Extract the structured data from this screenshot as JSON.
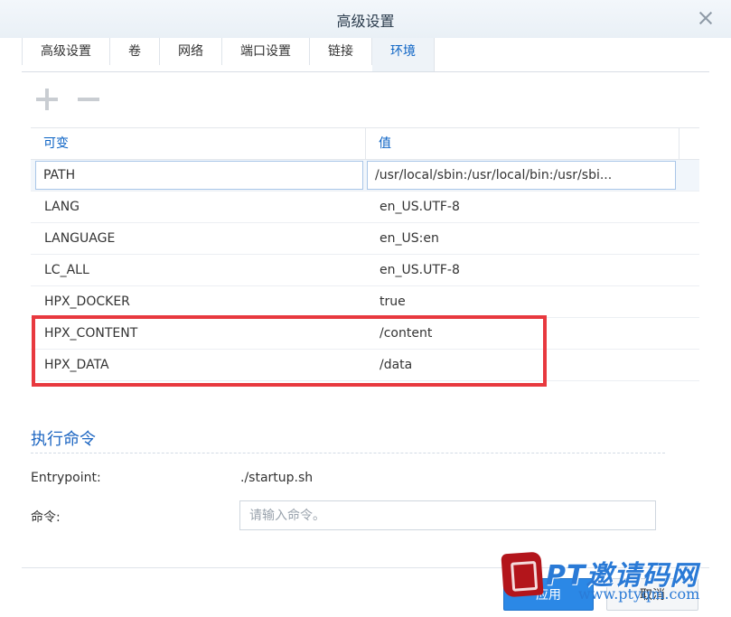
{
  "window": {
    "title": "高级设置"
  },
  "tabs": [
    {
      "label": "高级设置",
      "active": false
    },
    {
      "label": "卷",
      "active": false
    },
    {
      "label": "网络",
      "active": false
    },
    {
      "label": "端口设置",
      "active": false
    },
    {
      "label": "链接",
      "active": false
    },
    {
      "label": "环境",
      "active": true
    }
  ],
  "env_table": {
    "headers": {
      "key": "可变",
      "value": "值"
    },
    "edit_row": {
      "key": "PATH",
      "value": "/usr/local/sbin:/usr/local/bin:/usr/sbi..."
    },
    "rows": [
      {
        "key": "LANG",
        "value": "en_US.UTF-8"
      },
      {
        "key": "LANGUAGE",
        "value": "en_US:en"
      },
      {
        "key": "LC_ALL",
        "value": "en_US.UTF-8"
      },
      {
        "key": "HPX_DOCKER",
        "value": "true"
      },
      {
        "key": "HPX_CONTENT",
        "value": "/content"
      },
      {
        "key": "HPX_DATA",
        "value": "/data"
      }
    ]
  },
  "exec_section": {
    "title": "执行命令",
    "entrypoint_label": "Entrypoint:",
    "entrypoint_value": "./startup.sh",
    "command_label": "命令:",
    "command_placeholder": "请输入命令。"
  },
  "footer": {
    "apply_label": "应用",
    "cancel_label": "取消"
  },
  "watermark": {
    "title": "PT邀请码网",
    "url": "www.ptyqm.com"
  },
  "colors": {
    "accent": "#0a62c4",
    "highlight": "#e8393f",
    "primary_button": "#2b88e6"
  }
}
